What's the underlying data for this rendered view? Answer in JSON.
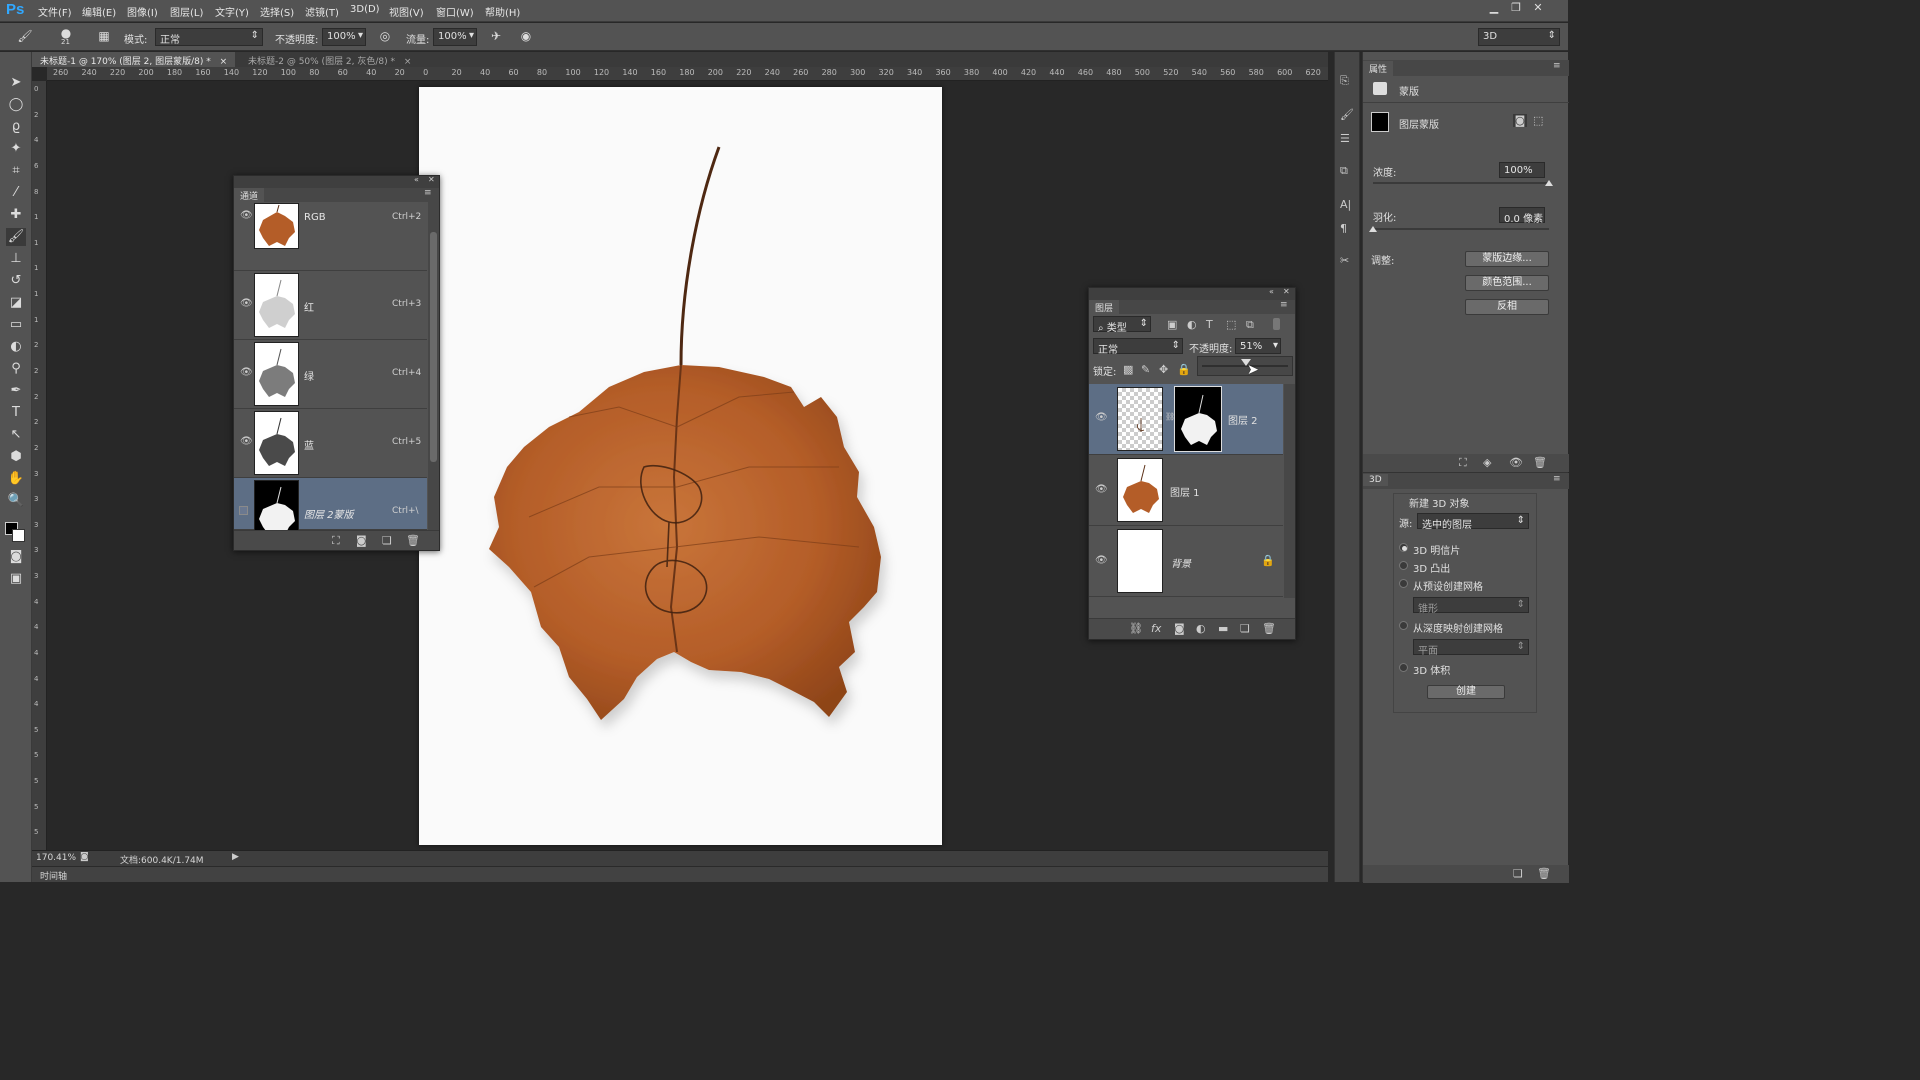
{
  "app": {
    "logo": "Ps"
  },
  "menu": [
    "文件(F)",
    "编辑(E)",
    "图像(I)",
    "图层(L)",
    "文字(Y)",
    "选择(S)",
    "滤镜(T)",
    "3D(D)",
    "视图(V)",
    "窗口(W)",
    "帮助(H)"
  ],
  "window_controls": [
    "minimize-icon",
    "restore-icon",
    "close-icon"
  ],
  "options": {
    "brush_size": "21",
    "mode_label": "模式:",
    "mode_value": "正常",
    "opacity_label": "不透明度:",
    "opacity_value": "100%",
    "flow_label": "流量:",
    "flow_value": "100%",
    "workspace": "3D"
  },
  "doc_tabs": [
    {
      "label": "未标题-1 @ 170% (图层 2, 图层蒙版/8) *",
      "close": "×",
      "active": true
    },
    {
      "label": "未标题-2 @ 50% (图层 2, 灰色/8) *",
      "close": "×",
      "active": false
    }
  ],
  "rulers": {
    "h": [
      "260",
      "240",
      "220",
      "200",
      "180",
      "160",
      "140",
      "120",
      "100",
      "80",
      "60",
      "40",
      "20",
      "0",
      "20",
      "40",
      "60",
      "80",
      "100",
      "120",
      "140",
      "160",
      "180",
      "200",
      "220",
      "240",
      "260",
      "280",
      "300",
      "320",
      "340",
      "360",
      "380",
      "400",
      "420",
      "440",
      "460",
      "480",
      "500",
      "520",
      "540",
      "560",
      "580",
      "600",
      "620"
    ],
    "v": [
      "0",
      "2",
      "4",
      "6",
      "8",
      "1",
      "1",
      "1",
      "1",
      "1",
      "2",
      "2",
      "2",
      "2",
      "2",
      "3",
      "3",
      "3",
      "3",
      "3",
      "4",
      "4",
      "4",
      "4",
      "4",
      "5",
      "5",
      "5",
      "5",
      "5"
    ]
  },
  "channels_panel": {
    "title": "通道",
    "rows": [
      {
        "name": "RGB",
        "shortcut": "Ctrl+2",
        "visible": true,
        "thumb": "leaf-color"
      },
      {
        "name": "红",
        "shortcut": "Ctrl+3",
        "visible": true,
        "thumb": "leaf-light"
      },
      {
        "name": "绿",
        "shortcut": "Ctrl+4",
        "visible": true,
        "thumb": "leaf-mid"
      },
      {
        "name": "蓝",
        "shortcut": "Ctrl+5",
        "visible": true,
        "thumb": "leaf-dark"
      },
      {
        "name": "图层 2蒙版",
        "shortcut": "Ctrl+\\",
        "visible": false,
        "selected": true,
        "thumb": "mask"
      }
    ]
  },
  "layers_panel": {
    "title": "图层",
    "filter": "类型",
    "blend_mode": "正常",
    "opacity_label": "不透明度:",
    "opacity_value": "51%",
    "lock_label": "锁定:",
    "layers": [
      {
        "name": "图层 2",
        "selected": true
      },
      {
        "name": "图层 1",
        "selected": false
      },
      {
        "name": "背景",
        "selected": false,
        "locked": true
      }
    ]
  },
  "properties_panel": {
    "title": "属性",
    "mask_label": "蒙版",
    "layer_mask_label": "图层蒙版",
    "density_label": "浓度:",
    "density_value": "100%",
    "density_level": 1.0,
    "feather_label": "羽化:",
    "feather_value": "0.0 像素",
    "feather_level": 0.0,
    "refine_label": "调整:",
    "buttons": [
      "蒙版边缘...",
      "颜色范围...",
      "反相"
    ]
  },
  "panel_3d": {
    "title": "3D",
    "new_object_label": "新建 3D 对象",
    "source_label": "源:",
    "source_value": "选中的图层",
    "options": [
      {
        "label": "3D 明信片",
        "selected": true
      },
      {
        "label": "3D 凸出",
        "selected": false
      },
      {
        "label": "从预设创建网格",
        "selected": false
      },
      {
        "label": "从深度映射创建网格",
        "selected": false
      },
      {
        "label": "3D 体积",
        "selected": false
      }
    ],
    "preset_value": "锥形",
    "depth_value": "平面",
    "create_button": "创建"
  },
  "status": {
    "zoom": "170.41%",
    "doc_size": "文档:600.4K/1.74M"
  },
  "timeline_label": "时间轴",
  "colors": {
    "chrome": "#535353",
    "canvas_bg": "#282828",
    "selection": "#5d6e85",
    "leaf": "#b05a26",
    "stem": "#5a2e14"
  }
}
